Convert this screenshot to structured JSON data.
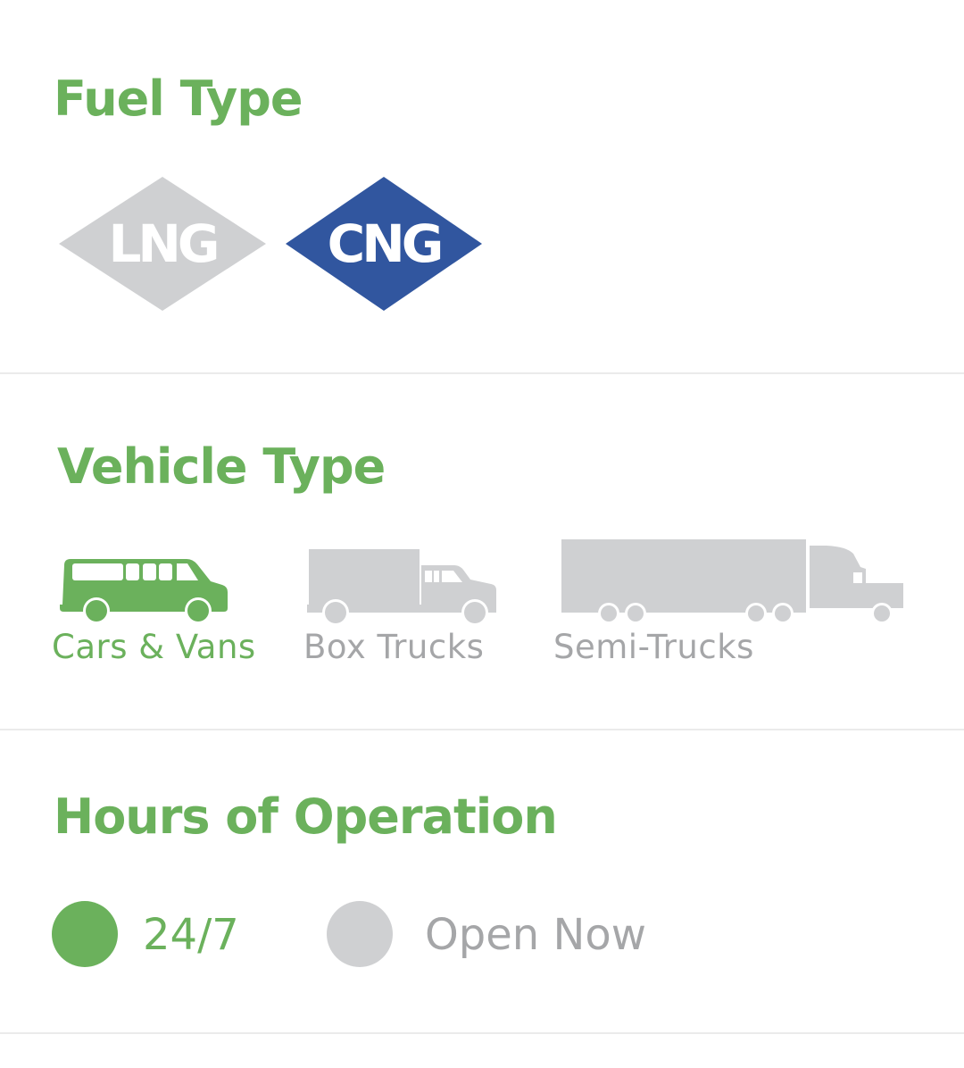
{
  "colors": {
    "green": "#6bb15c",
    "blue": "#31569f",
    "gray": "#cfd0d2",
    "gray_text": "#a5a6a8",
    "divider": "#ebebeb",
    "white": "#ffffff"
  },
  "fuel_type": {
    "title": "Fuel Type",
    "options": [
      {
        "label": "LNG",
        "selected": false,
        "icon": "lng-diamond-icon"
      },
      {
        "label": "CNG",
        "selected": true,
        "icon": "cng-diamond-icon"
      }
    ]
  },
  "vehicle_type": {
    "title": "Vehicle Type",
    "options": [
      {
        "label": "Cars & Vans",
        "selected": true,
        "icon": "van-icon"
      },
      {
        "label": "Box Trucks",
        "selected": false,
        "icon": "box-truck-icon"
      },
      {
        "label": "Semi-Trucks",
        "selected": false,
        "icon": "semi-truck-icon"
      }
    ]
  },
  "hours_of_operation": {
    "title": "Hours of Operation",
    "options": [
      {
        "label": "24/7",
        "selected": true
      },
      {
        "label": "Open Now",
        "selected": false
      }
    ]
  }
}
